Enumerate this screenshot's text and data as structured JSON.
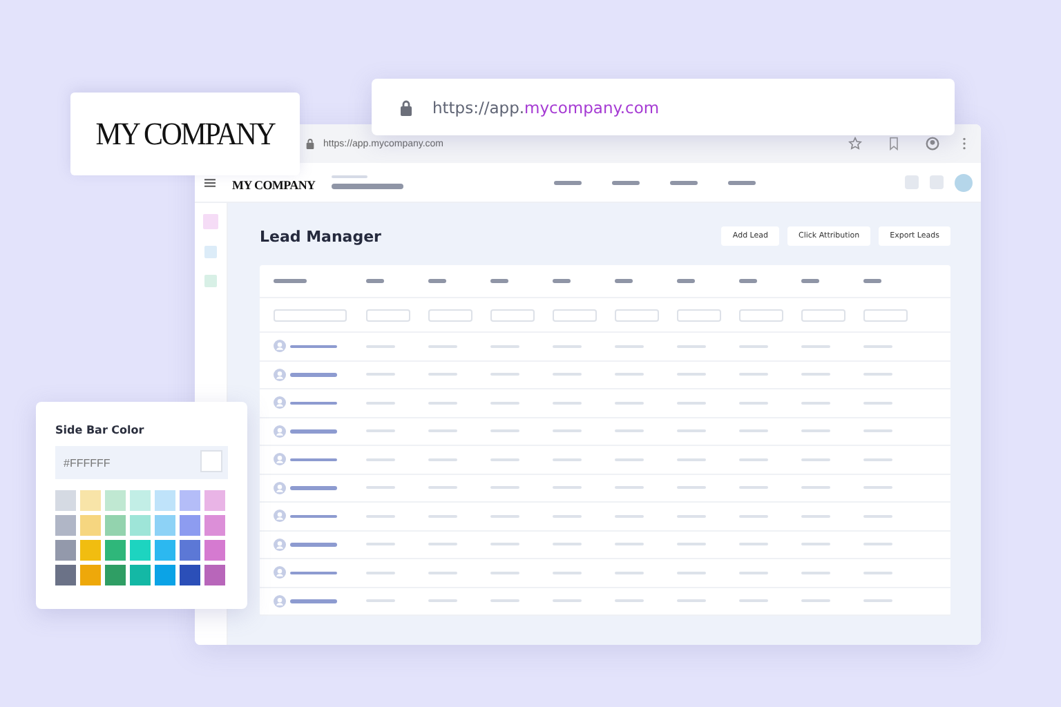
{
  "logo_card": {
    "logo": "MY COMPANY"
  },
  "address_bar": {
    "url": [
      {
        "text": "https://app.",
        "kind": "plain"
      },
      {
        "text": "mycompany.com",
        "kind": "highlight"
      }
    ]
  },
  "browser": {
    "url": "https://app.mycompany.com"
  },
  "app_header": {
    "logo": "MY COMPANY"
  },
  "sidebar": {
    "items": [
      {
        "color": "#f5dcf6"
      },
      {
        "color": "#dcecf8"
      },
      {
        "color": "#d8f0e6"
      }
    ]
  },
  "page": {
    "title": "Lead Manager",
    "buttons": [
      "Add Lead",
      "Click Attribution",
      "Export Leads"
    ]
  },
  "color_picker": {
    "title": "Side Bar Color",
    "value": "#FFFFFF",
    "swatches": [
      {
        "color": "#d5dae3"
      },
      {
        "color": "#f8e4a8"
      },
      {
        "color": "#c0e8d2"
      },
      {
        "color": "#c2eee6"
      },
      {
        "color": "#bfe3fa"
      },
      {
        "color": "#b4bdf8"
      },
      {
        "color": "#e9b4e6"
      },
      {
        "color": "#b0b6c6"
      },
      {
        "color": "#f6d680"
      },
      {
        "color": "#93d3ae"
      },
      {
        "color": "#9ee5d8"
      },
      {
        "color": "#8dd2f6"
      },
      {
        "color": "#8d9cf0"
      },
      {
        "color": "#dc8fd8"
      },
      {
        "color": "#9399ab"
      },
      {
        "color": "#f1bd10"
      },
      {
        "color": "#2fb77a"
      },
      {
        "color": "#1dd4c0"
      },
      {
        "color": "#2cb8f0"
      },
      {
        "color": "#5c78d6"
      },
      {
        "color": "#d57ad0"
      },
      {
        "color": "#6b7287"
      },
      {
        "color": "#eea80a"
      },
      {
        "color": "#2f9e64"
      },
      {
        "color": "#14b8a5"
      },
      {
        "color": "#0ba3e6"
      },
      {
        "color": "#2b4fb8"
      },
      {
        "color": "#b866ba"
      }
    ]
  }
}
